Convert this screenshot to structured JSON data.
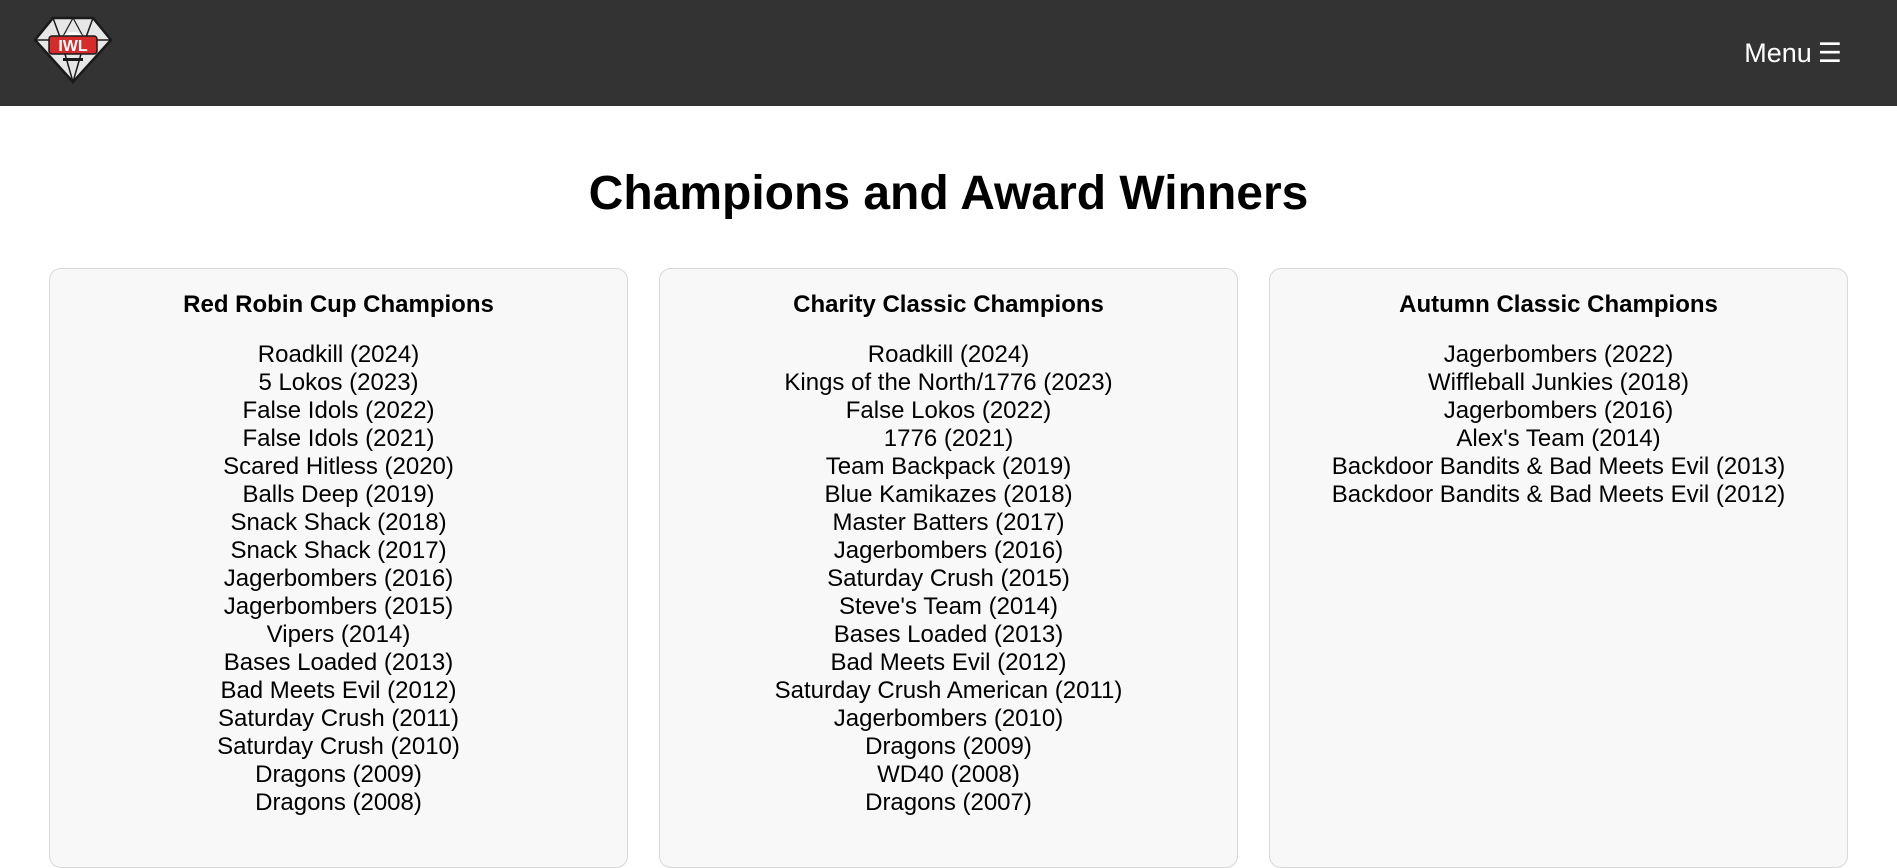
{
  "header": {
    "menu_label": "Menu",
    "menu_glyph": "☰",
    "logo_icon": "diamond-logo-icon",
    "logo_text": "IWL"
  },
  "page": {
    "title": "Champions and Award Winners"
  },
  "colors": {
    "header_bg": "#333333",
    "card_bg": "#f8f8f8",
    "logo_red": "#d62b2b"
  },
  "cards": [
    {
      "title": "Red Robin Cup Champions",
      "items": [
        "Roadkill (2024)",
        "5 Lokos (2023)",
        "False Idols (2022)",
        "False Idols (2021)",
        "Scared Hitless (2020)",
        "Balls Deep (2019)",
        "Snack Shack (2018)",
        "Snack Shack (2017)",
        "Jagerbombers (2016)",
        "Jagerbombers (2015)",
        "Vipers (2014)",
        "Bases Loaded (2013)",
        "Bad Meets Evil (2012)",
        "Saturday Crush (2011)",
        "Saturday Crush (2010)",
        "Dragons (2009)",
        "Dragons (2008)"
      ]
    },
    {
      "title": "Charity Classic Champions",
      "items": [
        "Roadkill (2024)",
        "Kings of the North/1776 (2023)",
        "False Lokos (2022)",
        "1776 (2021)",
        "Team Backpack (2019)",
        "Blue Kamikazes (2018)",
        "Master Batters (2017)",
        "Jagerbombers (2016)",
        "Saturday Crush (2015)",
        "Steve's Team (2014)",
        "Bases Loaded (2013)",
        "Bad Meets Evil (2012)",
        "Saturday Crush American (2011)",
        "Jagerbombers (2010)",
        "Dragons (2009)",
        "WD40 (2008)",
        "Dragons (2007)"
      ]
    },
    {
      "title": "Autumn Classic Champions",
      "items": [
        "Jagerbombers (2022)",
        "Wiffleball Junkies (2018)",
        "Jagerbombers (2016)",
        "Alex's Team (2014)",
        "Backdoor Bandits & Bad Meets Evil (2013)",
        "Backdoor Bandits & Bad Meets Evil (2012)"
      ]
    }
  ]
}
